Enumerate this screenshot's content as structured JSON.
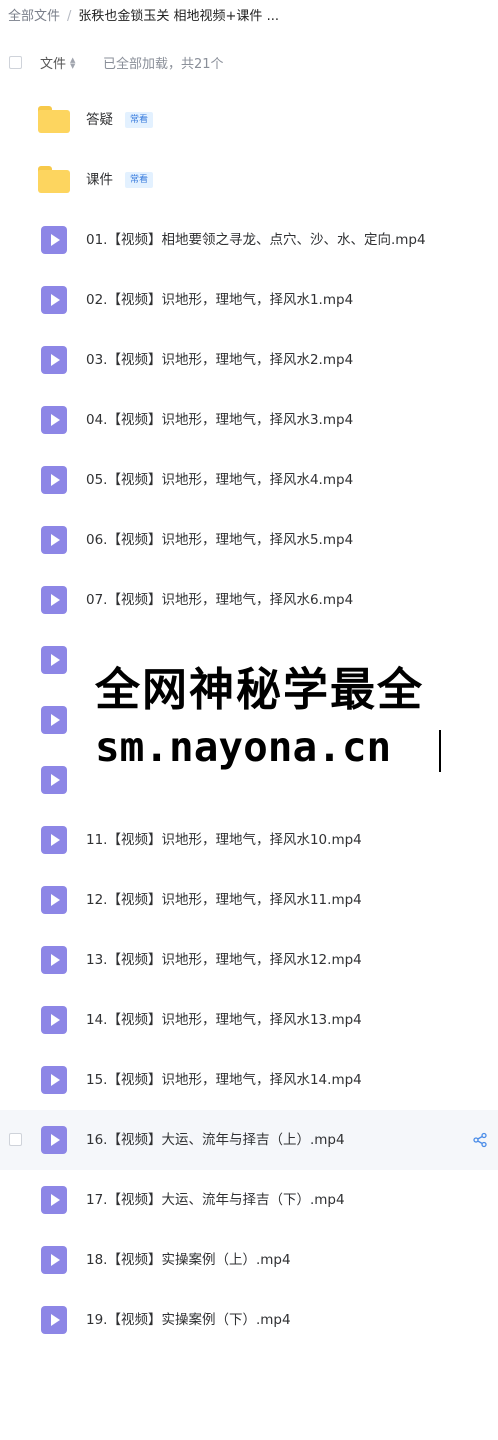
{
  "breadcrumb": {
    "root": "全部文件",
    "separator": "/",
    "current": "张秩也金锁玉关 相地视频+课件 ..."
  },
  "header": {
    "column_name": "文件",
    "load_status": "已全部加载，共21个"
  },
  "files": [
    {
      "name": "答疑",
      "type": "folder",
      "badge": "常看"
    },
    {
      "name": "课件",
      "type": "folder",
      "badge": "常看"
    },
    {
      "name": "01.【视频】相地要领之寻龙、点穴、沙、水、定向.mp4",
      "type": "video"
    },
    {
      "name": "02.【视频】识地形，理地气，择风水1.mp4",
      "type": "video"
    },
    {
      "name": "03.【视频】识地形，理地气，择风水2.mp4",
      "type": "video"
    },
    {
      "name": "04.【视频】识地形，理地气，择风水3.mp4",
      "type": "video"
    },
    {
      "name": "05.【视频】识地形，理地气，择风水4.mp4",
      "type": "video"
    },
    {
      "name": "06.【视频】识地形，理地气，择风水5.mp4",
      "type": "video"
    },
    {
      "name": "07.【视频】识地形，理地气，择风水6.mp4",
      "type": "video"
    },
    {
      "name": "",
      "type": "video"
    },
    {
      "name": "",
      "type": "video"
    },
    {
      "name": "",
      "type": "video"
    },
    {
      "name": "11.【视频】识地形，理地气，择风水10.mp4",
      "type": "video"
    },
    {
      "name": "12.【视频】识地形，理地气，择风水11.mp4",
      "type": "video"
    },
    {
      "name": "13.【视频】识地形，理地气，择风水12.mp4",
      "type": "video"
    },
    {
      "name": "14.【视频】识地形，理地气，择风水13.mp4",
      "type": "video"
    },
    {
      "name": "15.【视频】识地形，理地气，择风水14.mp4",
      "type": "video"
    },
    {
      "name": "16.【视频】大运、流年与择吉（上）.mp4",
      "type": "video",
      "hovered": true
    },
    {
      "name": "17.【视频】大运、流年与择吉（下）.mp4",
      "type": "video"
    },
    {
      "name": "18.【视频】实操案例（上）.mp4",
      "type": "video"
    },
    {
      "name": "19.【视频】实操案例（下）.mp4",
      "type": "video"
    }
  ],
  "overlay": {
    "line1": "全网神秘学最全",
    "line2": "sm.nayona.cn"
  },
  "icons": {
    "folder": "folder-icon",
    "video": "video-file-icon",
    "share": "share-icon",
    "sort": "sort-icon"
  },
  "colors": {
    "folder": "#fdd55f",
    "video": "#8d86e6",
    "badge_bg": "#e3f1ff",
    "badge_text": "#3b7ddd",
    "share": "#4a8ce8"
  }
}
